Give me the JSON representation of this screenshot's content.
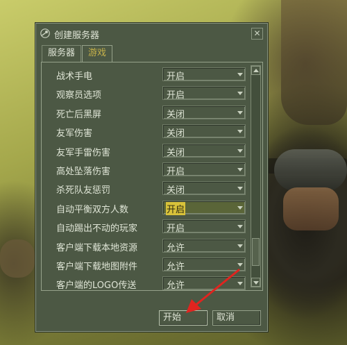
{
  "window": {
    "title": "创建服务器",
    "close_glyph": "✕"
  },
  "tabs": [
    {
      "label": "服务器",
      "active": false
    },
    {
      "label": "游戏",
      "active": true
    }
  ],
  "settings": [
    {
      "label": "战术手电",
      "value": "开启"
    },
    {
      "label": "观察员选项",
      "value": "开启"
    },
    {
      "label": "死亡后黑屏",
      "value": "关闭"
    },
    {
      "label": "友军伤害",
      "value": "关闭"
    },
    {
      "label": "友军手雷伤害",
      "value": "关闭"
    },
    {
      "label": "高处坠落伤害",
      "value": "开启"
    },
    {
      "label": "杀死队友惩罚",
      "value": "关闭"
    },
    {
      "label": "自动平衡双方人数",
      "value": "开启",
      "highlighted": true
    },
    {
      "label": "自动踢出不动的玩家",
      "value": "开启"
    },
    {
      "label": "客户端下载本地资源",
      "value": "允许"
    },
    {
      "label": "客户端下载地图附件",
      "value": "允许"
    },
    {
      "label": "客户端的LOGO传送",
      "value": "允许"
    }
  ],
  "buttons": {
    "start": "开始",
    "cancel": "取消"
  },
  "colors": {
    "dialog_bg": "#4c5844",
    "active_tab_text": "#c7b24a",
    "highlight_value": "#d8c23a",
    "annotation_arrow": "#e0241f"
  },
  "icons": {
    "app": "steam-icon",
    "close": "close-icon",
    "dropdown": "chevron-down-icon",
    "scroll_up": "scroll-up-icon",
    "scroll_down": "scroll-down-icon",
    "annotation": "red-arrow-annotation"
  }
}
